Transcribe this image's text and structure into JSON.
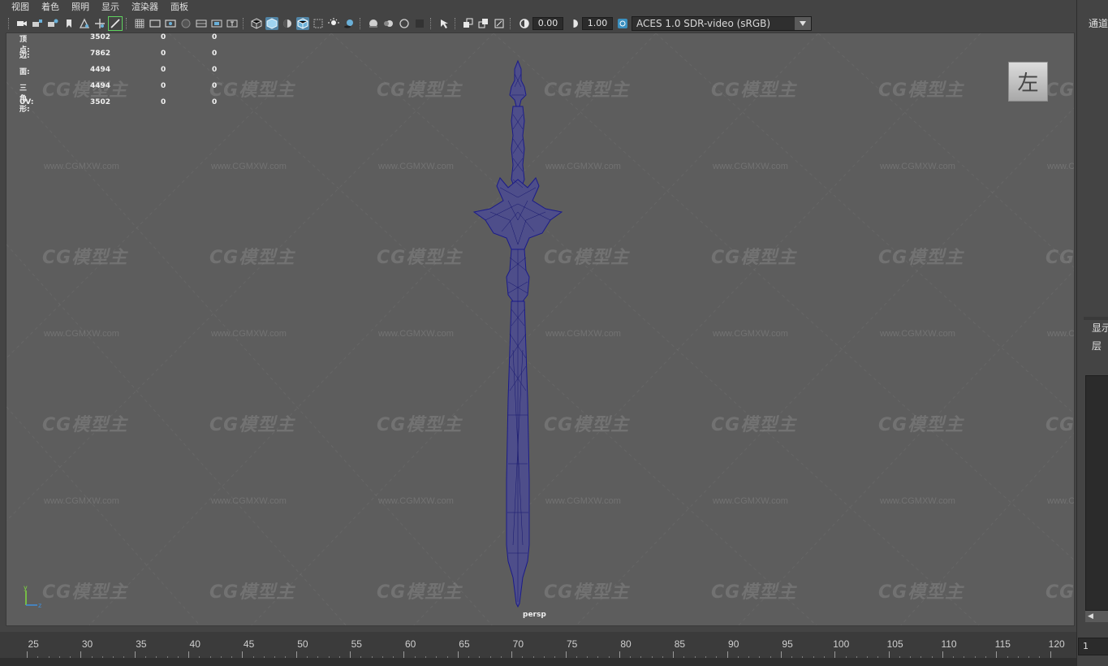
{
  "menubar": {
    "items": [
      "视图",
      "着色",
      "照明",
      "显示",
      "渲染器",
      "面板"
    ]
  },
  "toolbar": {
    "exposure_value": "0.00",
    "gamma_value": "1.00",
    "color_space": "ACES 1.0 SDR-video (sRGB)",
    "icons": [
      "camera-icon",
      "camera-lock-icon",
      "camera-attrs-icon",
      "bookmark-icon",
      "image-plane-icon",
      "2d-pan-icon",
      "grease-pencil-icon",
      "grid-icon",
      "film-gate-icon",
      "resolution-gate-icon",
      "gate-mask-icon",
      "field-chart-icon",
      "safe-action-icon",
      "safe-title-icon",
      "wireframe-icon",
      "smooth-shade-icon",
      "default-material-icon",
      "wireframe-on-shaded-icon",
      "xray-icon",
      "use-all-lights-icon",
      "shadows-icon",
      "screen-space-ao-icon",
      "motion-blur-icon",
      "multisample-aa-icon",
      "depth-of-field-icon",
      "isolate-select-icon",
      "xray-joints-icon",
      "xray-active-icon",
      "backface-culling-icon",
      "exposure-icon",
      "gamma-icon",
      "color-management-icon"
    ]
  },
  "hud": {
    "rows": [
      {
        "label": "顶点:",
        "v1": "3502",
        "v2": "0",
        "v3": "0"
      },
      {
        "label": "边:",
        "v1": "7862",
        "v2": "0",
        "v3": "0"
      },
      {
        "label": "面:",
        "v1": "4494",
        "v2": "0",
        "v3": "0"
      },
      {
        "label": "三角形:",
        "v1": "4494",
        "v2": "0",
        "v3": "0"
      },
      {
        "label": "UV:",
        "v1": "3502",
        "v2": "0",
        "v3": "0"
      }
    ]
  },
  "viewport": {
    "camera": "persp",
    "view_cube_face": "左",
    "watermark_logo": "CG模型主",
    "watermark_url": "www.CGMXW.com",
    "axis": {
      "y": "y",
      "z": "z"
    },
    "background_color": "#5d5d5d",
    "wireframe_color": "#1b1b8a"
  },
  "right_panel": {
    "channel_tab": "通道盒",
    "display_tab": "显示",
    "layer_tab": "层",
    "scroll_left": "◀",
    "current_frame": "1"
  },
  "timeline": {
    "ticks": [
      "25",
      "30",
      "35",
      "40",
      "45",
      "50",
      "55",
      "60",
      "65",
      "70",
      "75",
      "80",
      "85",
      "90",
      "95",
      "100",
      "105",
      "110",
      "115",
      "120"
    ]
  }
}
